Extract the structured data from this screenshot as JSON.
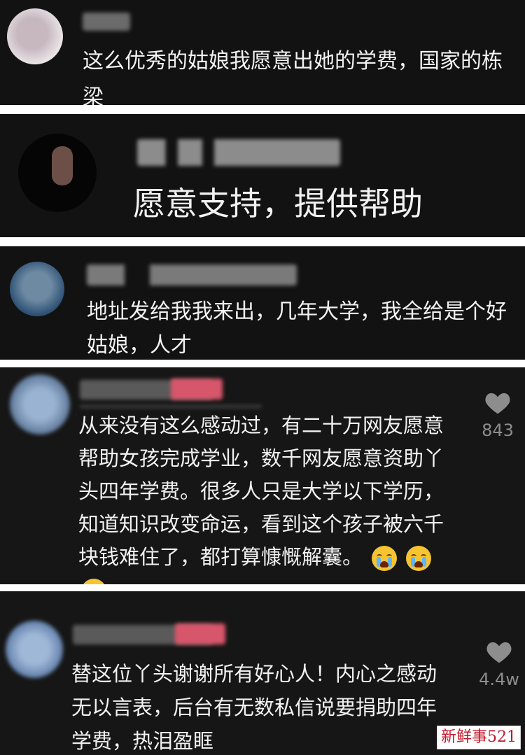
{
  "comments": [
    {
      "text": "这么优秀的姑娘我愿意出她的学费，国家的栋梁"
    },
    {
      "text": "愿意支持，提供帮助"
    },
    {
      "text": "地址发给我我来出，几年大学，我全给是个好姑娘，人才"
    },
    {
      "text": "从来没有这么感动过，有二十万网友愿意帮助女孩完成学业，数千网友愿意资助丫头四年学费。很多人只是大学以下学历，知道知识改变命运，看到这个孩子被六千块钱难住了，都打算慷慨解囊。",
      "likes": "843",
      "emoji": "loudly-crying-face"
    },
    {
      "text": "替这位丫头谢谢所有好心人！内心之感动无以言表，后台有无数私信说要捐助四年学费，热泪盈眶",
      "likes": "4.4w"
    }
  ],
  "watermark": {
    "text": "新鲜事521"
  },
  "colors": {
    "panel_bg": "#121212",
    "text": "#f2f2f2",
    "like_icon": "#8d8d8d",
    "watermark_text": "#c0192d"
  }
}
